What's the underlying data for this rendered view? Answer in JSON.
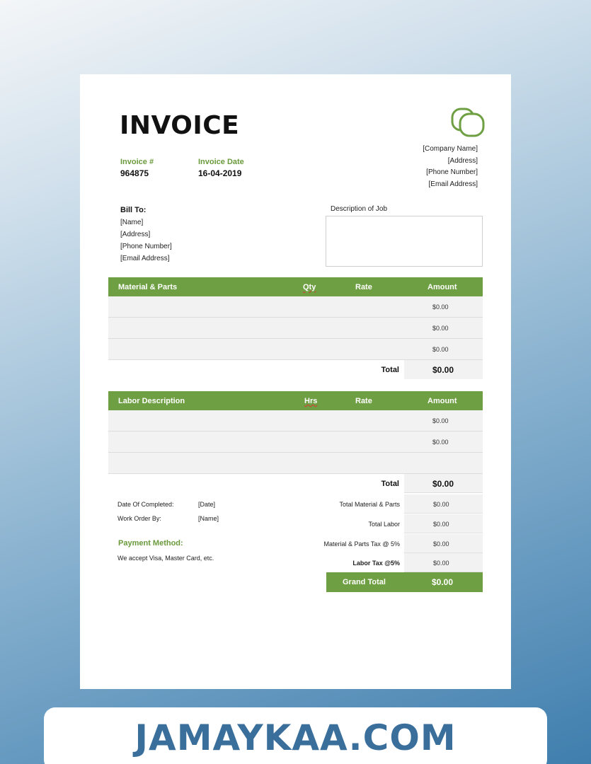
{
  "invoice": {
    "title": "INVOICE",
    "invoice_number_label": "Invoice #",
    "invoice_number": "964875",
    "invoice_date_label": "Invoice Date",
    "invoice_date": "16-04-2019"
  },
  "company": {
    "name": "[Company Name]",
    "address": "[Address]",
    "phone": "[Phone Number]",
    "email": "[Email Address]"
  },
  "bill_to": {
    "label": "Bill To:",
    "name": "[Name]",
    "address": "[Address]",
    "phone": "[Phone Number]",
    "email": "[Email Address]"
  },
  "job": {
    "description_label": "Description of Job"
  },
  "materials": {
    "headers": [
      "Material & Parts",
      "Qty",
      "Rate",
      "Amount"
    ],
    "rows": [
      {
        "amount": "$0.00"
      },
      {
        "amount": "$0.00"
      },
      {
        "amount": "$0.00"
      }
    ],
    "total_label": "Total",
    "total": "$0.00"
  },
  "labor": {
    "headers": [
      "Labor Description",
      "Hrs",
      "Rate",
      "Amount"
    ],
    "rows": [
      {
        "amount": "$0.00"
      },
      {
        "amount": "$0.00"
      },
      {
        "amount": ""
      }
    ],
    "total_label": "Total",
    "total": "$0.00"
  },
  "details": {
    "date_completed_label": "Date Of Completed:",
    "date_completed": "[Date]",
    "work_order_label": "Work Order By:",
    "work_order": "[Name]",
    "payment_label": "Payment Method:",
    "payment_text": "We accept Visa, Master Card, etc."
  },
  "summary": {
    "rows": [
      {
        "label": "Total Material  & Parts",
        "value": "$0.00"
      },
      {
        "label": "Total Labor",
        "value": "$0.00"
      },
      {
        "label": "Material  & Parts Tax @ 5%",
        "value": "$0.00"
      },
      {
        "label": "Labor Tax @5%",
        "value": "$0.00"
      }
    ],
    "grand_total_label": "Grand Total",
    "grand_total": "$0.00"
  },
  "footer": {
    "brand": "JAMAYKAA.COM"
  },
  "colors": {
    "accent": "#6ea043",
    "brand": "#3a6f9c"
  },
  "icons": {
    "logo": "overlapping-rounded-squares-logo-icon"
  }
}
